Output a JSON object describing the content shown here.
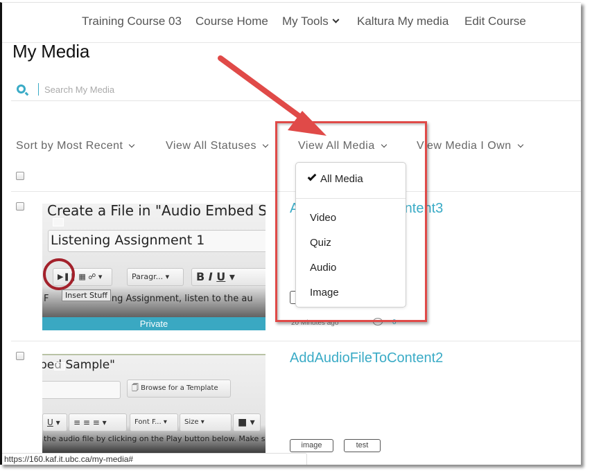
{
  "topnav": {
    "items": [
      {
        "label": "Training Course 03"
      },
      {
        "label": "Course Home"
      },
      {
        "label": "My Tools",
        "has_dropdown": true
      },
      {
        "label": "Kaltura My media"
      },
      {
        "label": "Edit Course"
      }
    ]
  },
  "page": {
    "title": "My Media"
  },
  "search": {
    "placeholder": "Search My Media",
    "value": "",
    "icon": "search-icon"
  },
  "filters": [
    {
      "label": "Sort by Most Recent"
    },
    {
      "label": "View All Statuses"
    },
    {
      "label": "View All Media"
    },
    {
      "label": "View Media I Own"
    }
  ],
  "media_dropdown": {
    "selected": "All Media",
    "options": [
      "All Media",
      "Video",
      "Quiz",
      "Audio",
      "Image"
    ]
  },
  "entries": [
    {
      "title": "AddAudioFileToContent3",
      "status_label": "Private",
      "timestamp": "20 Minutes ago",
      "comments": "0",
      "thumbnail": {
        "heading": "Create a File in \"Audio Embed S",
        "field_value": "Listening Assignment 1",
        "format_select": "Paragr...",
        "tooltip": "Insert Stuff",
        "body_before": "F",
        "body_after": "ning Assignment, listen to the au"
      }
    },
    {
      "title": "AddAudioFileToContent2",
      "tags": [
        "image",
        "test"
      ],
      "thumbnail": {
        "heading": "bed Sample\"",
        "button_label": "Browse for a Template",
        "font_select": "Font F...",
        "size_select": "Size",
        "body": "the audio file by clicking on the Play button below.  Make s"
      }
    }
  ],
  "statusbar": {
    "url": "https://160.kaf.it.ubc.ca/my-media#"
  },
  "annotation": {
    "color": "#e04a48"
  }
}
